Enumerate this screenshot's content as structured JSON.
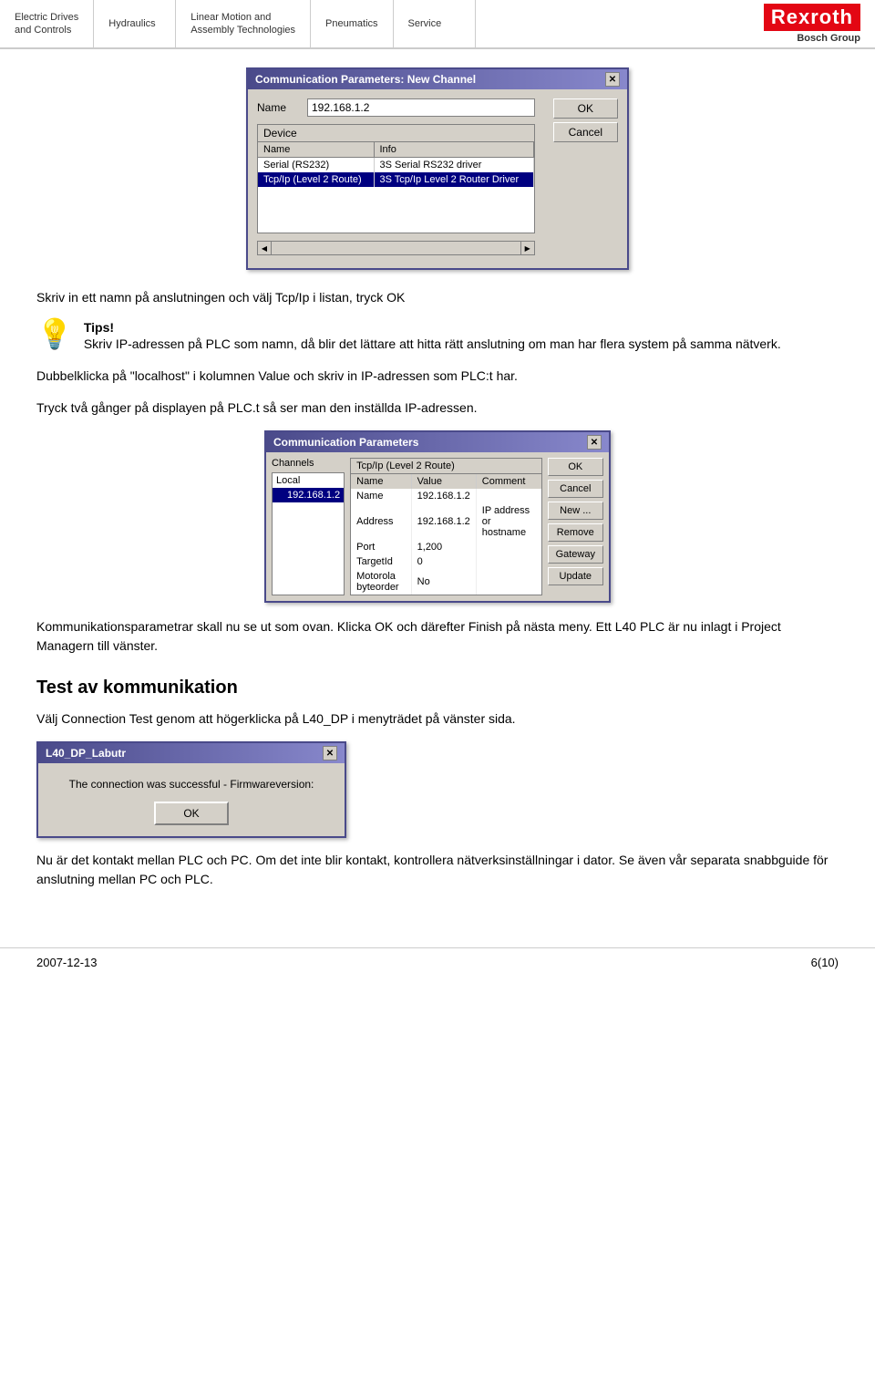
{
  "header": {
    "nav_items": [
      {
        "label": "Electric Drives\nand Controls",
        "active": false
      },
      {
        "label": "Hydraulics",
        "active": false
      },
      {
        "label": "Linear Motion and\nAssembly Technologies",
        "active": false
      },
      {
        "label": "Pneumatics",
        "active": false
      },
      {
        "label": "Service",
        "active": false
      }
    ],
    "logo": {
      "brand": "Rexroth",
      "group": "Bosch Group"
    }
  },
  "dialog1": {
    "title": "Communication Parameters: New Channel",
    "name_label": "Name",
    "name_value": "192.168.1.2",
    "ok_label": "OK",
    "cancel_label": "Cancel",
    "device_label": "Device",
    "table_headers": [
      "Name",
      "Info"
    ],
    "table_rows": [
      {
        "name": "Serial (RS232)",
        "info": "3S Serial RS232 driver",
        "selected": false
      },
      {
        "name": "Tcp/Ip (Level 2 Route)",
        "info": "3S Tcp/Ip Level 2 Router Driver",
        "selected": true
      }
    ]
  },
  "instruction1": "Skriv in ett namn på anslutningen och välj Tcp/Ip i listan, tryck OK",
  "tips": {
    "icon": "💡",
    "label": "Tips!",
    "text": "Skriv IP-adressen på PLC som namn, då blir det lättare att hitta rätt anslutning om man har flera system på samma nätverk."
  },
  "instruction2a": "Dubbelklicka på \"localhost\" i kolumnen Value och skriv in IP-adressen som PLC:t har.",
  "instruction2b": "Tryck två gånger på displayen på PLC.t så ser man den inställda IP-adressen.",
  "comm_dialog": {
    "title": "Communication Parameters",
    "channels_label": "Channels",
    "left_items": [
      {
        "label": "Local",
        "selected": false
      },
      {
        "label": "192.168.1.2",
        "selected": true
      }
    ],
    "right_header": [
      "Tcp/Ip (Level 2 Route)"
    ],
    "right_rows": [
      {
        "name": "Name",
        "value": "192.168.1.2",
        "comment": ""
      },
      {
        "name": "Address",
        "value": "192.168.1.2",
        "comment": "IP address or hostname"
      },
      {
        "name": "Port",
        "value": "1,200",
        "comment": ""
      },
      {
        "name": "TargetId",
        "value": "0",
        "comment": ""
      },
      {
        "name": "Motorola byteorder",
        "value": "No",
        "comment": ""
      }
    ],
    "buttons": [
      "OK",
      "Cancel",
      "New ...",
      "Remove",
      "Gateway",
      "Update"
    ]
  },
  "instruction3": "Kommunikationsparametrar skall nu se ut som ovan. Klicka OK och därefter Finish på nästa meny. Ett L40 PLC är nu inlagt i Project Managern till vänster.",
  "section_heading": "Test av kommunikation",
  "instruction4": "Välj Connection Test genom att högerklicka på L40_DP i menyträdet på vänster sida.",
  "conn_dialog": {
    "title": "L40_DP_Labutr",
    "message": "The connection was successful - Firmwareversion:",
    "ok_label": "OK"
  },
  "instruction5": "Nu är det kontakt mellan PLC och PC. Om det inte blir kontakt, kontrollera nätverksinställningar i dator. Se även vår separata snabbguide för anslutning mellan PC och PLC.",
  "footer": {
    "date": "2007-12-13",
    "page": "6(10)"
  }
}
